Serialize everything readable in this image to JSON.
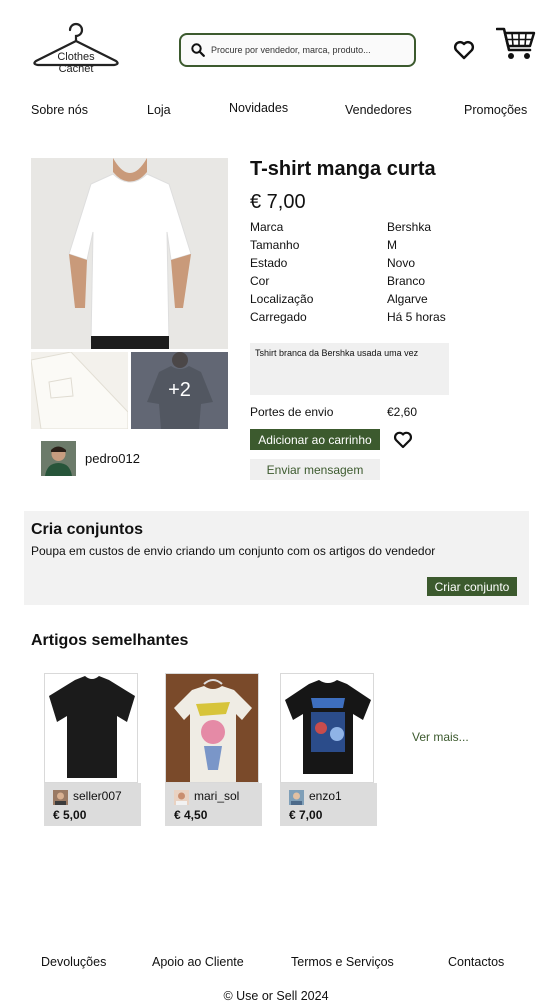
{
  "header": {
    "logo_line1": "Clothes",
    "logo_line2": "Cachet",
    "search_placeholder": "Procure por vendedor, marca, produto...",
    "icons": [
      "search-icon",
      "heart-icon",
      "cart-icon"
    ]
  },
  "nav": {
    "items": [
      "Sobre nós",
      "Loja",
      "Novidades",
      "Vendedores",
      "Promoções"
    ]
  },
  "product": {
    "title": "T-shirt manga curta",
    "price": "€ 7,00",
    "attributes": [
      {
        "label": "Marca",
        "value": "Bershka"
      },
      {
        "label": "Tamanho",
        "value": "M"
      },
      {
        "label": "Estado",
        "value": "Novo"
      },
      {
        "label": "Cor",
        "value": "Branco"
      },
      {
        "label": "Localização",
        "value": "Algarve"
      },
      {
        "label": "Carregado",
        "value": "Há 5 horas"
      }
    ],
    "description": "Tshirt branca da Bershka usada uma vez",
    "shipping_label": "Portes de envio",
    "shipping_value": "€2,60",
    "add_to_cart": "Adicionar ao carrinho",
    "send_message": "Enviar mensagem",
    "more_photos": "+2",
    "seller": "pedro012"
  },
  "bundle": {
    "title": "Cria conjuntos",
    "subtitle": "Poupa em custos de envio criando um conjunto com os artigos do vendedor",
    "button": "Criar conjunto"
  },
  "similar": {
    "title": "Artigos semelhantes",
    "items": [
      {
        "seller": "seller007",
        "price": "€ 5,00"
      },
      {
        "seller": "mari_sol",
        "price": "€ 4,50"
      },
      {
        "seller": "enzo1",
        "price": "€ 7,00"
      }
    ],
    "see_more": "Ver mais..."
  },
  "footer": {
    "links": [
      "Devoluções",
      "Apoio ao Cliente",
      "Termos e Serviços",
      "Contactos"
    ],
    "copyright": "© Use or Sell 2024"
  },
  "colors": {
    "accent": "#3c5a2e",
    "panel": "#f2f2f2",
    "card_info": "#dcdcdc"
  }
}
